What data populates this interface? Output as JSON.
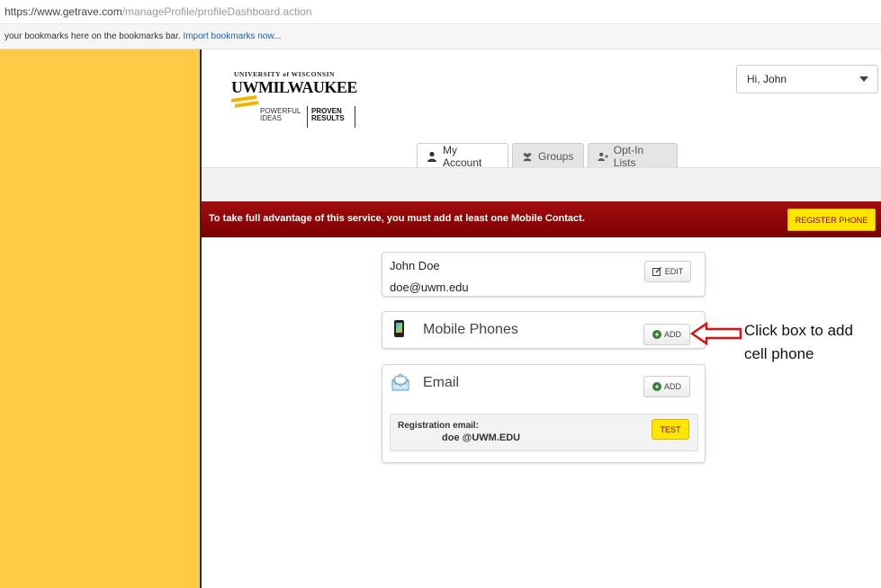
{
  "browser": {
    "url_scheme_host": "https://www.getrave.com",
    "url_path": "/manageProfile/profileDashboard.action",
    "bookmarks_text": "your bookmarks here on the bookmarks bar.",
    "bookmarks_link": "Import bookmarks now..."
  },
  "logo": {
    "top": "UNIVERSITY of WISCONSIN",
    "main": "UWMILWAUKEE",
    "tagline1a": "POWERFUL",
    "tagline1b": "IDEAS",
    "tagline2a": "PROVEN",
    "tagline2b": "RESULTS"
  },
  "user_menu": {
    "greeting": "Hi,",
    "name": "John"
  },
  "tabs": [
    {
      "label": "My Account",
      "icon": "person-icon",
      "active": true
    },
    {
      "label": "Groups",
      "icon": "group-icon",
      "active": false
    },
    {
      "label": "Opt-In Lists",
      "icon": "person-add-icon",
      "active": false
    }
  ],
  "alert": {
    "message": "To take full advantage of this service, you must add at least one Mobile Contact.",
    "button": "REGISTER PHONE"
  },
  "profile": {
    "name": "John Doe",
    "email": "doe@uwm.edu",
    "edit_label": "EDIT"
  },
  "mobile": {
    "title": "Mobile Phones",
    "add_label": "ADD"
  },
  "email_card": {
    "title": "Email",
    "add_label": "ADD",
    "reg_label": "Registration email:",
    "reg_value": "doe @UWM.EDU",
    "test_label": "TEST"
  },
  "annotation": {
    "line1": "Click box to add",
    "line2": "cell phone"
  },
  "colors": {
    "sidebar": "#ffcb47",
    "alert_bg": "#8b0000",
    "accent_yellow": "#ffe600",
    "add_green": "#2e7d32"
  }
}
